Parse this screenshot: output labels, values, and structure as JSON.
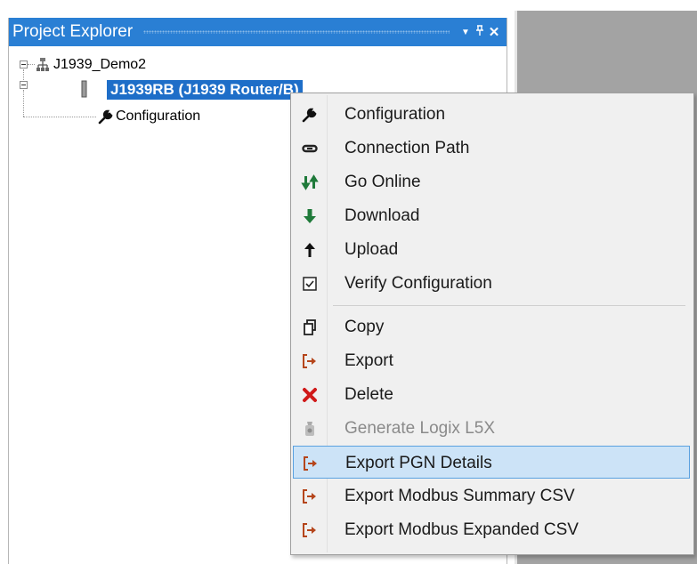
{
  "panel": {
    "title": "Project Explorer",
    "buttons": {
      "dropdown": "▼",
      "pin": "ᛘ",
      "close": "✕"
    }
  },
  "tree": {
    "root": {
      "label": "J1939_Demo2",
      "icon": "network-icon"
    },
    "device": {
      "label": "J1939RB (J1939 Router/B)",
      "icon": "device-module-icon"
    },
    "config": {
      "label": "Configuration",
      "icon": "wrench-icon"
    }
  },
  "menu": {
    "items": [
      {
        "label": "Configuration",
        "icon": "wrench-icon",
        "enabled": true
      },
      {
        "label": "Connection Path",
        "icon": "chain-link-icon",
        "enabled": true
      },
      {
        "label": "Go Online",
        "icon": "go-online-icon",
        "enabled": true
      },
      {
        "label": "Download",
        "icon": "download-arrow-icon",
        "enabled": true
      },
      {
        "label": "Upload",
        "icon": "upload-arrow-icon",
        "enabled": true
      },
      {
        "label": "Verify Configuration",
        "icon": "checkbox-icon",
        "enabled": true
      },
      {
        "label": "Copy",
        "icon": "copy-icon",
        "enabled": true
      },
      {
        "label": "Export",
        "icon": "export-icon",
        "enabled": true
      },
      {
        "label": "Delete",
        "icon": "delete-x-icon",
        "enabled": true
      },
      {
        "label": "Generate Logix L5X",
        "icon": "logix-icon",
        "enabled": false
      },
      {
        "label": "Export PGN Details",
        "icon": "export-icon",
        "enabled": true,
        "highlighted": true
      },
      {
        "label": "Export Modbus Summary CSV",
        "icon": "export-icon",
        "enabled": true
      },
      {
        "label": "Export Modbus Expanded CSV",
        "icon": "export-icon",
        "enabled": true
      }
    ]
  },
  "colors": {
    "titlebar": "#2a7fd4",
    "selection": "#1e6ec8",
    "menu_bg": "#f0f0f0",
    "menu_highlight": "#cce3f7",
    "go_green": "#1f7a3a",
    "delete_red": "#d01919",
    "export_orange": "#b5451b"
  }
}
